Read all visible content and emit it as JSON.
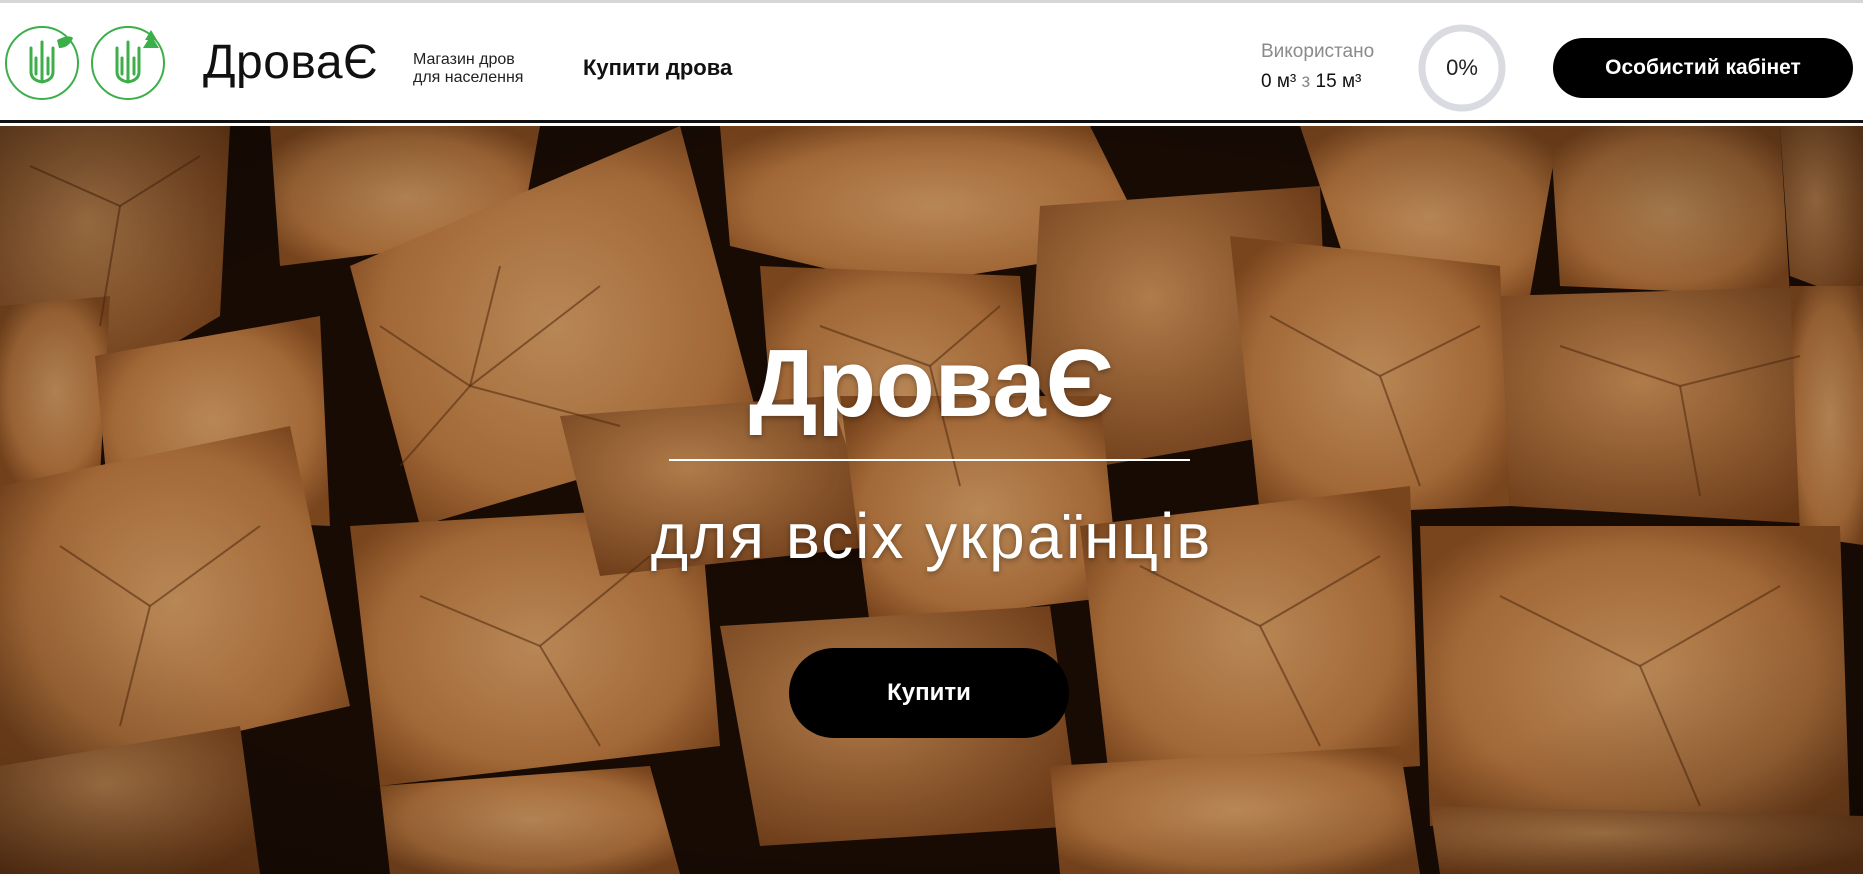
{
  "header": {
    "brand": "ДроваЄ",
    "tagline": "Магазин дров\nдля населення",
    "nav_buy": "Купити дрова",
    "usage": {
      "label": "Використано",
      "used": "0 м³",
      "separator": "з",
      "total": "15 м³",
      "percent_text": "0%",
      "percent": 0
    },
    "cabinet_button": "Особистий кабінет"
  },
  "hero": {
    "title": "ДроваЄ",
    "subtitle": "для всіх українців",
    "buy_button": "Купити"
  },
  "colors": {
    "accent_green": "#3cae4a",
    "button_bg": "#000000",
    "gauge_track": "#d9dbe0",
    "muted_text": "#8a8a8a"
  },
  "icons": {
    "logo_left": "trident-leaf-icon",
    "logo_right": "trident-tree-icon"
  }
}
